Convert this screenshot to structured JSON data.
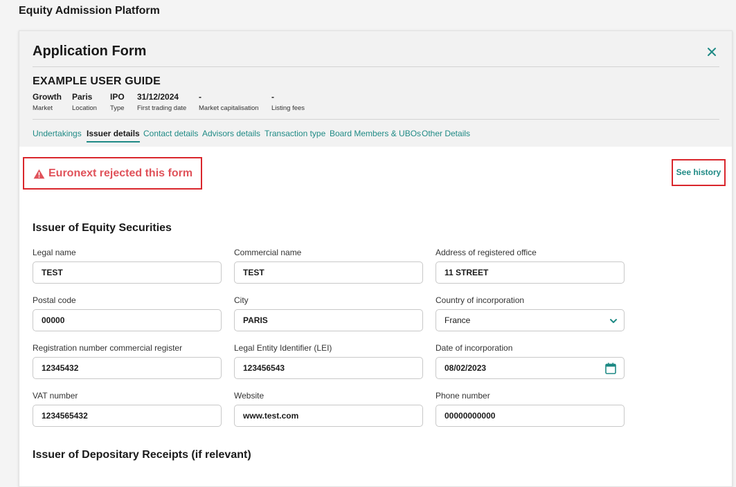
{
  "app": {
    "title": "Equity Admission Platform"
  },
  "form": {
    "title": "Application Form",
    "close_icon": "close-icon"
  },
  "guide": {
    "title": "EXAMPLE USER GUIDE",
    "meta": [
      {
        "value": "Growth",
        "label": "Market"
      },
      {
        "value": "Paris",
        "label": "Location"
      },
      {
        "value": "IPO",
        "label": "Type"
      },
      {
        "value": "31/12/2024",
        "label": "First trading date"
      },
      {
        "value": "-",
        "label": "Market capitalisation"
      },
      {
        "value": "-",
        "label": "Listing fees"
      }
    ]
  },
  "tabs": [
    {
      "label": "Undertakings",
      "active": false
    },
    {
      "label": "Issuer details",
      "active": true
    },
    {
      "label": "Contact details",
      "active": false
    },
    {
      "label": "Advisors details",
      "active": false
    },
    {
      "label": "Transaction type",
      "active": false
    },
    {
      "label": "Board Members & UBOs",
      "active": false
    },
    {
      "label": "Other Details",
      "active": false
    }
  ],
  "status": {
    "message": "Euronext rejected this form",
    "icon": "warning-icon",
    "color": "#e0525a"
  },
  "history": {
    "label": "See history"
  },
  "sections": {
    "issuer": {
      "title": "Issuer of Equity Securities",
      "fields": {
        "legal_name": {
          "label": "Legal name",
          "value": "TEST"
        },
        "commercial_name": {
          "label": "Commercial name",
          "value": "TEST"
        },
        "address": {
          "label": "Address of registered office",
          "value": "11 STREET"
        },
        "postal_code": {
          "label": "Postal code",
          "value": "00000"
        },
        "city": {
          "label": "City",
          "value": "PARIS"
        },
        "country": {
          "label": "Country of incorporation",
          "value": "France"
        },
        "reg_number": {
          "label": "Registration number commercial register",
          "value": "12345432"
        },
        "lei": {
          "label": "Legal Entity Identifier (LEI)",
          "value": "123456543"
        },
        "incorporation_date": {
          "label": "Date of incorporation",
          "value": "08/02/2023"
        },
        "vat": {
          "label": "VAT number",
          "value": "1234565432"
        },
        "website": {
          "label": "Website",
          "value": "www.test.com"
        },
        "phone": {
          "label": "Phone number",
          "value": "00000000000"
        }
      }
    },
    "depositary": {
      "title": "Issuer of Depositary Receipts (if relevant)"
    }
  },
  "colors": {
    "accent": "#1f8a85",
    "error": "#d9262c"
  }
}
